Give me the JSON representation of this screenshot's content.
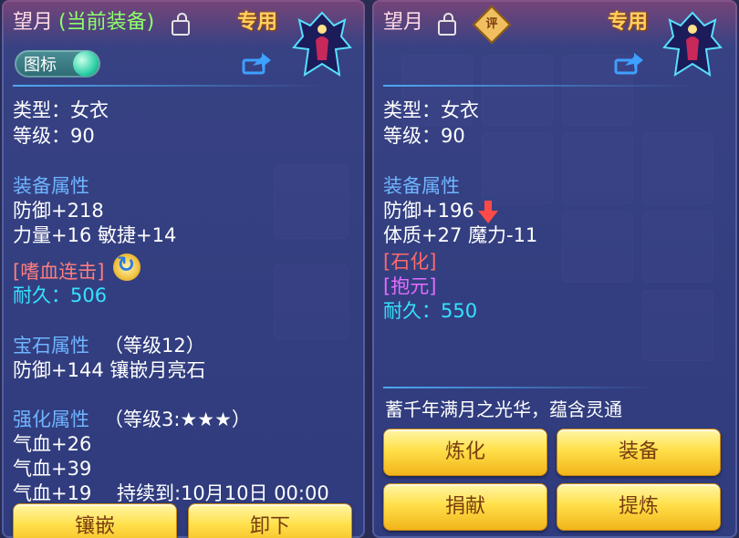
{
  "left": {
    "name": "望月",
    "equipped_tag": "(当前装备)",
    "special": "专用",
    "icon_toggle": "图标",
    "type_line": "类型：女衣",
    "level_line": "等级：90",
    "attr_header": "装备属性",
    "defense": "防御+218",
    "str_agi": "力量+16 敏捷+14",
    "skill": "[嗜血连击]",
    "durability": "耐久：506",
    "gem_header": "宝石属性",
    "gem_level": "（等级12）",
    "gem_bonus": "防御+144 镶嵌月亮石",
    "enhance_header": "强化属性",
    "enhance_level": "（等级3:★★★）",
    "hp1": "气血+26",
    "hp2": "气血+39",
    "hp3": "气血+19",
    "duration": "持续到:10月10日 00:00",
    "btn_inlay": "镶嵌",
    "btn_unequip": "卸下"
  },
  "right": {
    "name": "望月",
    "badge": "评",
    "special": "专用",
    "type_line": "类型：女衣",
    "level_line": "等级：90",
    "attr_header": "装备属性",
    "defense": "防御+196",
    "con_mag": "体质+27 魔力-11",
    "trait1": "[石化]",
    "trait2": "[抱元]",
    "durability": "耐久：550",
    "description": "蓄千年满月之光华，蕴含灵通",
    "btn_refine": "炼化",
    "btn_equip": "装备",
    "btn_donate": "捐献",
    "btn_extract": "提炼"
  }
}
